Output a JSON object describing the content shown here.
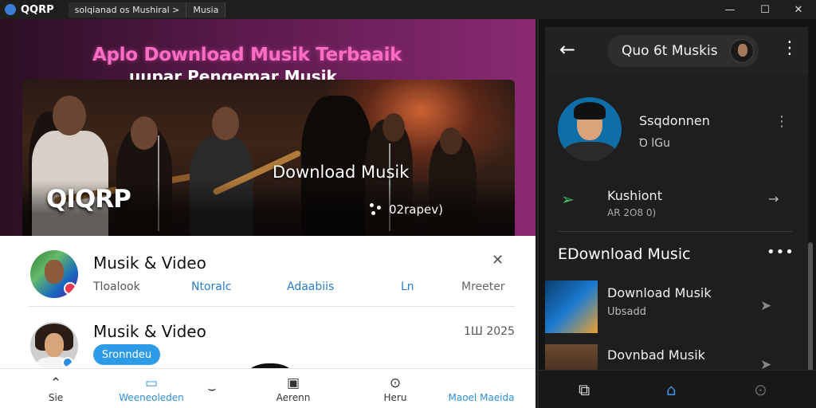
{
  "titlebar": {
    "app_name": "QQRP",
    "tabs": [
      "solqianad os Mushiral >",
      "Musia"
    ],
    "controls": {
      "minimize": "—",
      "maximize": "☐",
      "close": "✕"
    }
  },
  "left": {
    "hero": {
      "title": "Aplo Download Musik Terbaaik",
      "subtitle": "uupar Pengemar Musik",
      "banner_caption": "Download Musik",
      "banner_logo": "QIQRP",
      "banner_meta": "02rapev)"
    },
    "row1": {
      "title": "Musik & Video",
      "links": [
        "Tloalook",
        "Ntoralc",
        "Adaabiis",
        "Ln",
        "Mreeter"
      ],
      "close_icon": "✕"
    },
    "row2": {
      "title": "Musik & Video",
      "date": "1Ш 2025",
      "button": "Sronndeu"
    },
    "bottom_nav": [
      {
        "label": "Sie",
        "icon": "⌃"
      },
      {
        "label": "Weeneoleden",
        "icon": "▭"
      },
      {
        "label": "",
        "icon": "⌣"
      },
      {
        "label": "Aerenn",
        "icon": "▣"
      },
      {
        "label": "Heru",
        "icon": "⊙"
      },
      {
        "label": "Maoel Maeida",
        "icon": ""
      }
    ],
    "colors": {
      "accent": "#2d9be8",
      "hero_pink": "#ff6cc4"
    }
  },
  "right": {
    "search_label": "Quo 6t Muskis",
    "profile": {
      "name": "Ssqdonnen",
      "sub": "Ꝺ lGu"
    },
    "kushiont": {
      "title": "Kushiont",
      "sub": "AR 2O8 0)"
    },
    "section_title": "EDownload Music",
    "section_more": "•••",
    "items": [
      {
        "title": "Download Musik",
        "sub": "Ubsadd"
      },
      {
        "title": "Dovnbad Musik",
        "sub": ""
      }
    ],
    "bottom_nav": [
      "⧉",
      "⌂",
      "⊙"
    ]
  }
}
